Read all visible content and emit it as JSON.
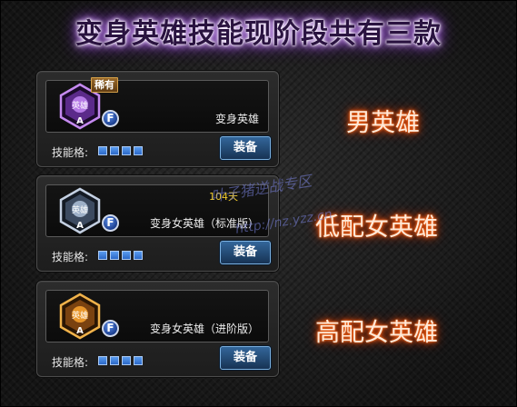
{
  "headline": "变身英雄技能现阶段共有三款",
  "cards": [
    {
      "rarity_tag": "稀有",
      "badge_text": "英雄",
      "grade": "A",
      "f_label": "F",
      "name": "变身英雄",
      "duration": "",
      "slots_label": "技能格:",
      "equip_label": "装备",
      "badge_color": "#9a4fd6"
    },
    {
      "rarity_tag": "",
      "badge_text": "英雄",
      "grade": "A",
      "f_label": "F",
      "name": "变身女英雄（标准版）",
      "duration": "104天",
      "slots_label": "技能格:",
      "equip_label": "装备",
      "badge_color": "#8fa2bd"
    },
    {
      "rarity_tag": "",
      "badge_text": "英雄",
      "grade": "A",
      "f_label": "F",
      "name": "变身女英雄（进阶版）",
      "duration": "",
      "slots_label": "技能格:",
      "equip_label": "装备",
      "badge_color": "#e09a2a"
    }
  ],
  "side_labels": [
    "男英雄",
    "低配女英雄",
    "高配女英雄"
  ],
  "watermark": {
    "line1": "叶子猪逆战专区",
    "line2": "http://nz.yzz.cn"
  }
}
